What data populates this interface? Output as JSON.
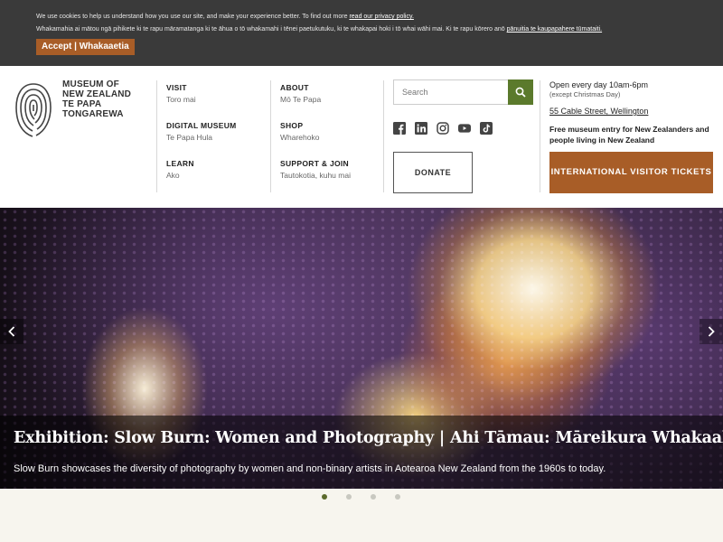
{
  "cookie": {
    "line1_text": "We use cookies to help us understand how you use our site, and make your experience better. To find out more ",
    "line1_link": "read our privacy policy.",
    "line2_text": "Whakamahia ai mātou ngā pihikete ki te rapu māramatanga ki te āhua o tō whakamahi i tēnei paetukutuku, ki te whakapai hoki i tō whai wāhi mai. Ki te rapu kōrero anō ",
    "line2_link": "pānuitia te kaupapahere tūmataiti.",
    "accept_label": "Accept | Whakaaetia"
  },
  "logo": {
    "line1": "MUSEUM OF",
    "line2": "NEW ZEALAND",
    "line3": "TE PAPA",
    "line4": "TONGAREWA"
  },
  "nav": {
    "col1": [
      {
        "title": "VISIT",
        "sub": "Toro mai"
      },
      {
        "title": "DIGITAL MUSEUM",
        "sub": "Te Papa Hula"
      },
      {
        "title": "LEARN",
        "sub": "Ako"
      }
    ],
    "col2": [
      {
        "title": "ABOUT",
        "sub": "Mō Te Papa"
      },
      {
        "title": "SHOP",
        "sub": "Wharehoko"
      },
      {
        "title": "SUPPORT & JOIN",
        "sub": "Tautokotia, kuhu mai"
      }
    ]
  },
  "search": {
    "placeholder": "Search"
  },
  "social": [
    "facebook-icon",
    "linkedin-icon",
    "instagram-icon",
    "youtube-icon",
    "tiktok-icon"
  ],
  "donate_label": "DONATE",
  "info": {
    "open": "Open every day 10am-6pm",
    "exception": "(except Christmas Day)",
    "address": "55 Cable Street, Wellington",
    "free": "Free museum entry for New Zealanders and people living in New Zealand"
  },
  "intl_button": "INTERNATIONAL VISITOR TICKETS",
  "hero": {
    "title": "Exhibition: Slow Burn: Women and Photography | Ahi Tāmau: Māreikura Whakaahua",
    "description": "Slow Burn showcases the diversity of photography by women and non-binary artists in Aotearoa New Zealand from the 1960s to today.",
    "slide_count": 4,
    "active_slide": 1
  },
  "colors": {
    "accent_orange": "#a85d27",
    "accent_green": "#5b7a2c",
    "cookie_bg": "#3a3a3a"
  }
}
